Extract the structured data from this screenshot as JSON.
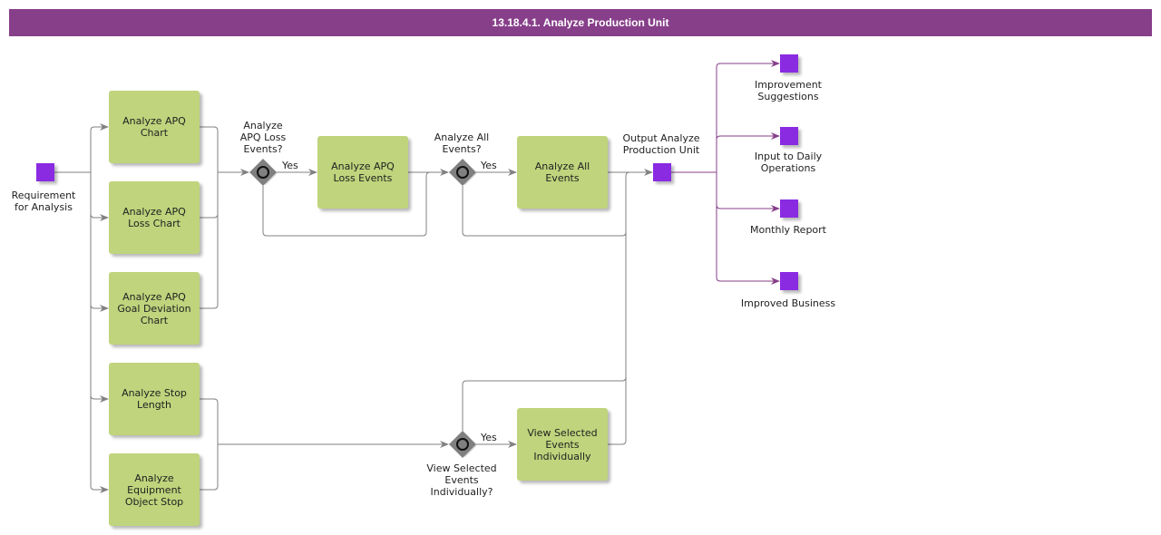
{
  "title": "13.18.4.1. Analyze Production Unit",
  "colors": {
    "header": "#873f8a",
    "task_fill": "#bfd47c",
    "data_object": "#8a2be2",
    "flow_line": "#808080",
    "output_line": "#873f8a",
    "gateway": "#808080"
  },
  "start": {
    "label": "Requirement\nfor Analysis"
  },
  "tasks": [
    {
      "id": "t1",
      "label": "Analyze APQ\nChart"
    },
    {
      "id": "t2",
      "label": "Analyze APQ\nLoss Chart"
    },
    {
      "id": "t3",
      "label": "Analyze APQ\nGoal Deviation\nChart"
    },
    {
      "id": "t4",
      "label": "Analyze Stop\nLength"
    },
    {
      "id": "t5",
      "label": "Analyze\nEquipment\nObject Stop"
    },
    {
      "id": "t6",
      "label": "Analyze APQ\nLoss Events"
    },
    {
      "id": "t7",
      "label": "Analyze All\nEvents"
    },
    {
      "id": "t8",
      "label": "View Selected\nEvents\nIndividually"
    }
  ],
  "gateways": [
    {
      "id": "g1",
      "label": "Analyze\nAPQ Loss\nEvents?",
      "yes_label": "Yes"
    },
    {
      "id": "g2",
      "label": "Analyze All\nEvents?",
      "yes_label": "Yes"
    },
    {
      "id": "g3",
      "label": "View Selected\nEvents\nIndividually?",
      "yes_label": "Yes"
    }
  ],
  "output": {
    "label": "Output Analyze\nProduction Unit"
  },
  "results": [
    {
      "label": "Improvement\nSuggestions"
    },
    {
      "label": "Input to Daily\nOperations"
    },
    {
      "label": "Monthly Report"
    },
    {
      "label": "Improved Business"
    }
  ]
}
